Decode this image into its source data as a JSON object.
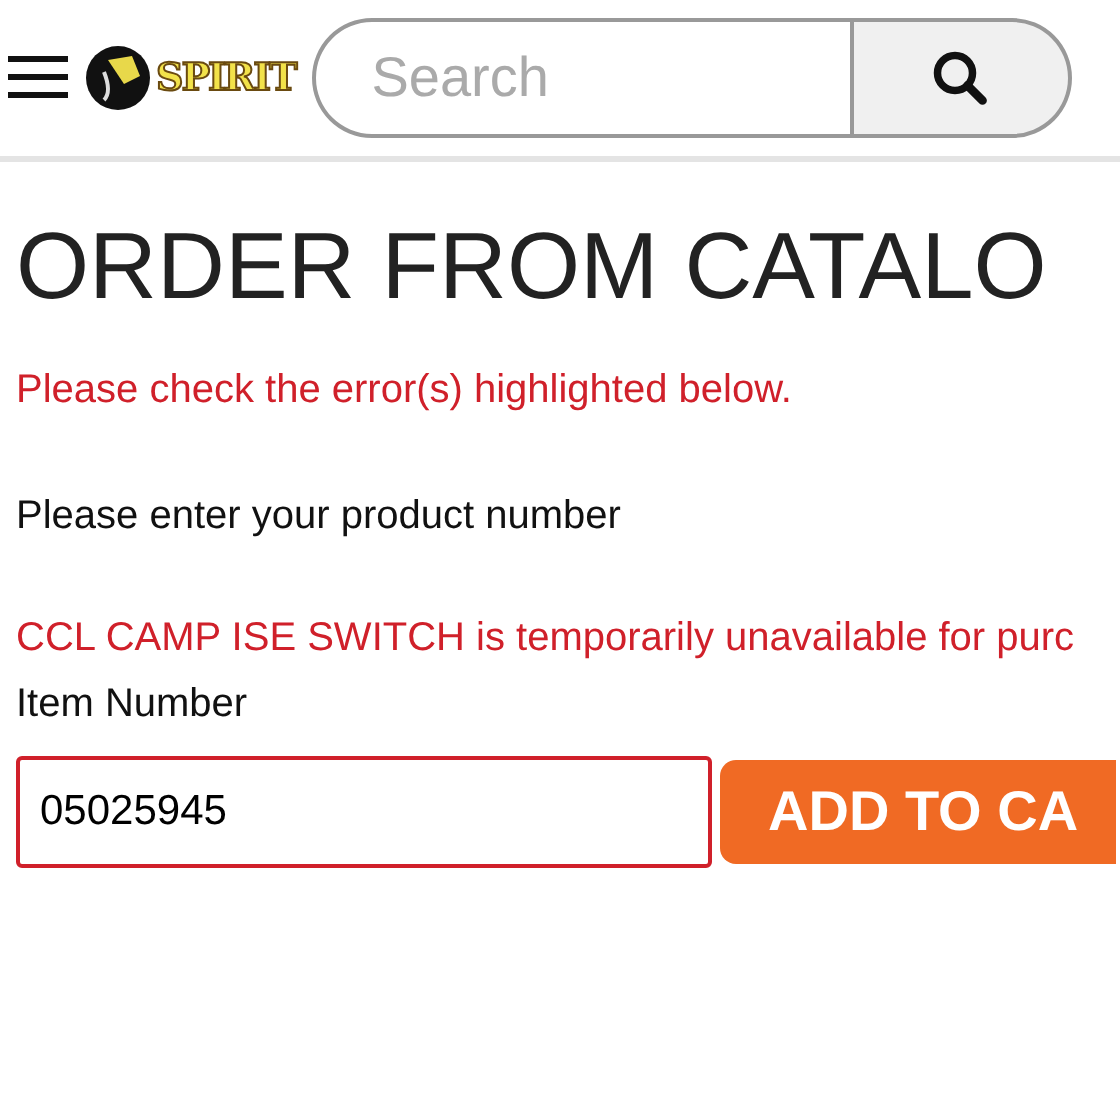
{
  "header": {
    "logo": "SPIRIT",
    "search": {
      "placeholder": "Search"
    }
  },
  "page": {
    "title": "ORDER FROM CATALO",
    "error": "Please check the error(s) highlighted below.",
    "instruction": "Please enter your product number",
    "notice": "CCL CAMP ISE SWITCH is temporarily unavailable for purc",
    "field_label": "Item Number",
    "item_number": {
      "value": "05025945",
      "invalid": true
    },
    "add_button": "ADD TO CA"
  }
}
